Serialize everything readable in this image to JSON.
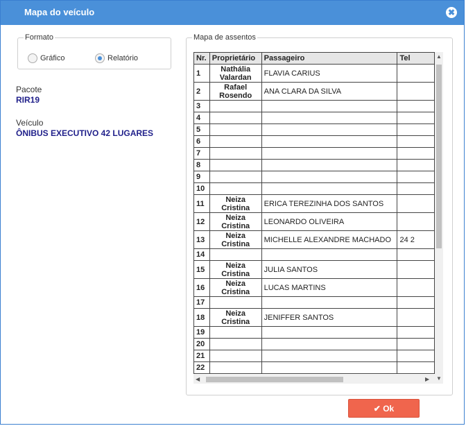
{
  "dialog": {
    "title": "Mapa do veículo",
    "close_glyph": "✖"
  },
  "formato": {
    "legend": "Formato",
    "option_grafico": "Gráfico",
    "option_relatorio": "Relatório",
    "selected": "Relatório"
  },
  "info": {
    "pacote_label": "Pacote",
    "pacote_value": "RIR19",
    "veiculo_label": "Veículo",
    "veiculo_value": "ÔNIBUS EXECUTIVO 42 LUGARES"
  },
  "mapa": {
    "legend": "Mapa de assentos",
    "headers": [
      "Nr.",
      "Proprietário",
      "Passageiro",
      "Tel"
    ],
    "rows": [
      {
        "nr": "1",
        "prop": "Nathália Valardan",
        "pass": "FLAVIA CARIUS",
        "tel": ""
      },
      {
        "nr": "2",
        "prop": "Rafael Rosendo",
        "pass": "ANA CLARA DA SILVA",
        "tel": ""
      },
      {
        "nr": "3",
        "prop": "",
        "pass": "",
        "tel": ""
      },
      {
        "nr": "4",
        "prop": "",
        "pass": "",
        "tel": ""
      },
      {
        "nr": "5",
        "prop": "",
        "pass": "",
        "tel": ""
      },
      {
        "nr": "6",
        "prop": "",
        "pass": "",
        "tel": ""
      },
      {
        "nr": "7",
        "prop": "",
        "pass": "",
        "tel": ""
      },
      {
        "nr": "8",
        "prop": "",
        "pass": "",
        "tel": ""
      },
      {
        "nr": "9",
        "prop": "",
        "pass": "",
        "tel": ""
      },
      {
        "nr": "10",
        "prop": "",
        "pass": "",
        "tel": ""
      },
      {
        "nr": "11",
        "prop": "Neiza Cristina",
        "pass": "ERICA TEREZINHA DOS SANTOS",
        "tel": ""
      },
      {
        "nr": "12",
        "prop": "Neiza Cristina",
        "pass": "LEONARDO OLIVEIRA",
        "tel": ""
      },
      {
        "nr": "13",
        "prop": "Neiza Cristina",
        "pass": "MICHELLE ALEXANDRE MACHADO",
        "tel": "24 2"
      },
      {
        "nr": "14",
        "prop": "",
        "pass": "",
        "tel": ""
      },
      {
        "nr": "15",
        "prop": "Neiza Cristina",
        "pass": "JULIA SANTOS",
        "tel": ""
      },
      {
        "nr": "16",
        "prop": "Neiza Cristina",
        "pass": "LUCAS MARTINS",
        "tel": ""
      },
      {
        "nr": "17",
        "prop": "",
        "pass": "",
        "tel": ""
      },
      {
        "nr": "18",
        "prop": "Neiza Cristina",
        "pass": "JENIFFER SANTOS",
        "tel": ""
      },
      {
        "nr": "19",
        "prop": "",
        "pass": "",
        "tel": ""
      },
      {
        "nr": "20",
        "prop": "",
        "pass": "",
        "tel": ""
      },
      {
        "nr": "21",
        "prop": "",
        "pass": "",
        "tel": ""
      },
      {
        "nr": "22",
        "prop": "",
        "pass": "",
        "tel": ""
      }
    ]
  },
  "footer": {
    "ok_label": "Ok",
    "ok_icon": "check-icon"
  },
  "colors": {
    "titlebar": "#4a90d9",
    "ok_button": "#f0654d",
    "value_text": "#1f1f8a"
  }
}
